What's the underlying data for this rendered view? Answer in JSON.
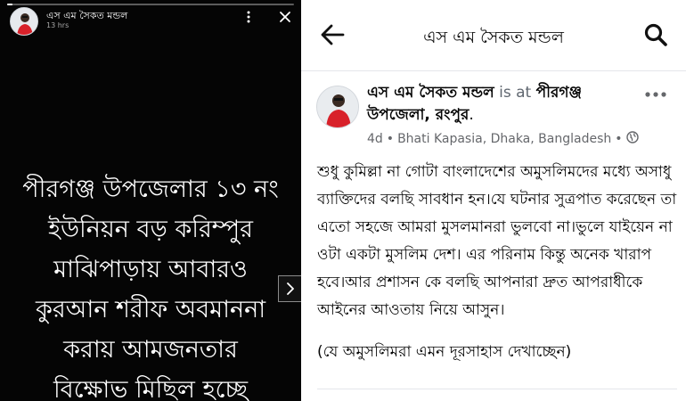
{
  "story": {
    "progress": 0.02,
    "author_name": "এস এম সৈকত মন্ডল",
    "time": "13 hrs",
    "icons": {
      "more": "vertical-dots-icon",
      "close": "close-icon",
      "next": "chevron-right-icon"
    },
    "text": "পীরগঞ্জ উপজেলার ১৩ নং\nইউনিয়ন বড় করিম্পুর\nমাঝিপাড়ায় আবারও\nকুরআন শরীফ অবমাননা\nকরায় আমজনতার\nবিক্ষোভ মিছিল হচ্ছে"
  },
  "post_view": {
    "title": "এস এম সৈকত মন্ডল",
    "icons": {
      "back": "back-arrow-icon",
      "search": "search-icon",
      "menu": "horizontal-dots-icon",
      "privacy": "globe-icon"
    },
    "post": {
      "author": "এস এম সৈকত মন্ডল",
      "is_at": "is at",
      "place": "পীরগঞ্জ উপজেলা, রংপুর",
      "period": ".",
      "time": "4d",
      "location": "Bhati Kapasia, Dhaka, Bangladesh",
      "paragraph1": "শুধু কুমিল্লা না গোটা বাংলাদেশের অমুসলিমদের মধ্যে অসাধু ব্যাক্তিদের বলছি সাবধান হন।যে ঘটনার সুত্রপাত করেছেন তা এতো সহজে আমরা মুসলমানরা ভুলবো না।ভুলে যাইয়েন না ওটা একটা মুসলিম দেশ। এর পরিনাম কিন্তু অনেক খারাপ হবে।আর প্রশাসন কে বলছি আপনারা দ্রুত আপরাধীকে আইনের আওতায় নিয়ে আসুন।",
      "paragraph2": "(যে অমুসলিমরা এমন দূরসাহাস দেখাচ্ছেন)"
    }
  },
  "colors": {
    "story_bg": "#050505",
    "meta_gray": "#65676b",
    "text_black": "#050505"
  }
}
